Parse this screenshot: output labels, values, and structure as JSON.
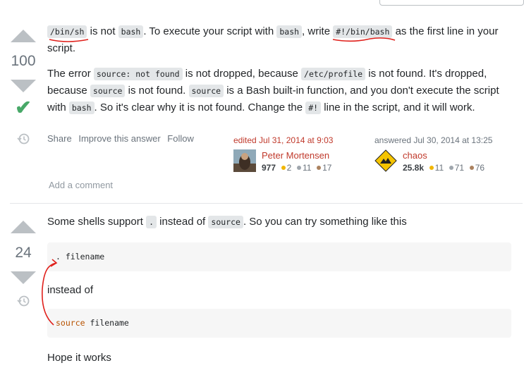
{
  "answer1": {
    "score": "100",
    "p1": {
      "code1": "/bin/sh",
      "t1": " is not ",
      "code2": "bash",
      "t2": ". To execute your script with ",
      "code3": "bash",
      "t3": ", write ",
      "code4": "#!/bin/bash",
      "t4": " as the first line in your script."
    },
    "p2": {
      "t1": "The error ",
      "code1": "source: not found",
      "t2": " is not dropped, because ",
      "code2": "/etc/profile",
      "t3": " is not found. It's dropped, because ",
      "code3": "source",
      "t4": " is not found. ",
      "code4": "source",
      "t5": " is a Bash built-in function, and you don't execute the script with ",
      "code5": "bash",
      "t6": ". So it's clear why it is not found. Change the ",
      "code6": "#!",
      "t7": " line in the script, and it will work."
    },
    "actions": {
      "share": "Share",
      "improve": "Improve this answer",
      "follow": "Follow"
    },
    "edited": {
      "label": "edited Jul 31, 2014 at 9:03",
      "user": "Peter Mortensen",
      "rep": "977",
      "gold": "2",
      "silver": "11",
      "bronze": "17"
    },
    "answered": {
      "label": "answered Jul 30, 2014 at 13:25",
      "user": "chaos",
      "rep": "25.8k",
      "gold": "11",
      "silver": "71",
      "bronze": "76"
    },
    "add_comment": "Add a comment"
  },
  "answer2": {
    "score": "24",
    "p1": {
      "t1": "Some shells support ",
      "code1": ".",
      "t2": " instead of ",
      "code2": "source",
      "t3": ". So you can try something like this"
    },
    "pre1": ". filename",
    "p2": "instead of",
    "pre2": {
      "kw": "source",
      "rest": " filename"
    },
    "p3": "Hope it works"
  },
  "colors": {
    "annotation": "#e0201b",
    "accepted": "#48a868",
    "vote_arrow": "#bbc0c4"
  }
}
